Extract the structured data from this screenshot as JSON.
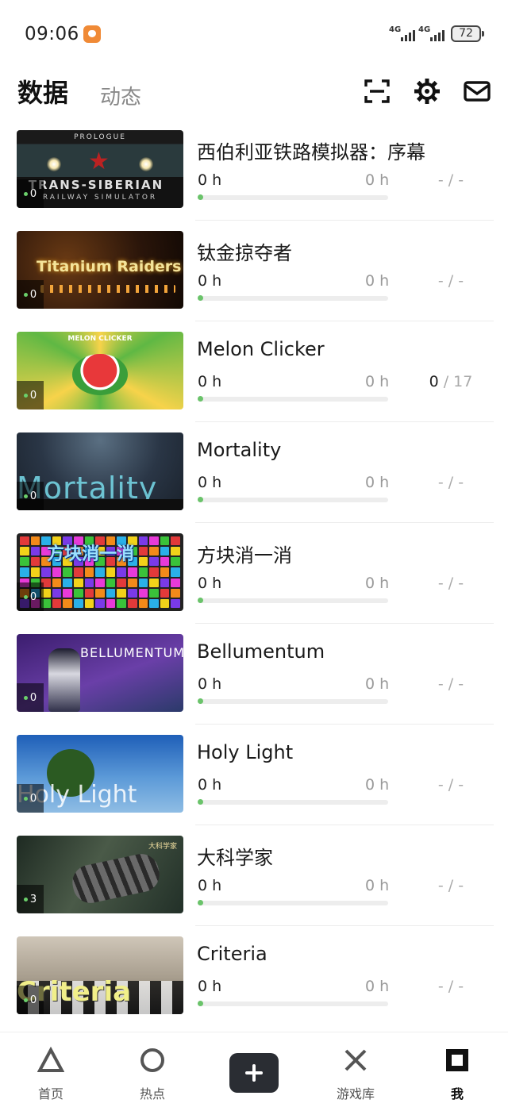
{
  "status_bar": {
    "time": "09:06",
    "network_1": "4G",
    "network_2": "4G",
    "battery": "72"
  },
  "header": {
    "tab_active": "数据",
    "tab_inactive": "动态",
    "icons": [
      "scan-icon",
      "gear-icon",
      "mail-icon"
    ]
  },
  "games": [
    {
      "title": "西伯利亚铁路模拟器：序幕",
      "badge": "0",
      "hours_left": "0 h",
      "hours_right": "0 h",
      "achieved": "",
      "achievements": "- / -",
      "progress": 0,
      "art": "siberian",
      "art_text": [
        "PROLOGUE",
        "TRANS-SIBERIAN",
        "RAILWAY SIMULATOR"
      ]
    },
    {
      "title": "钛金掠夺者",
      "badge": "0",
      "hours_left": "0 h",
      "hours_right": "0 h",
      "achieved": "",
      "achievements": "- / -",
      "progress": 0,
      "art": "titanium",
      "art_text": [
        "Titanium Raiders"
      ]
    },
    {
      "title": "Melon Clicker",
      "badge": "0",
      "hours_left": "0 h",
      "hours_right": "0 h",
      "achieved": "0",
      "achievements": " / 17",
      "progress": 0,
      "art": "melon",
      "art_text": [
        "MELON CLICKER"
      ]
    },
    {
      "title": "Mortality",
      "badge": "0",
      "hours_left": "0 h",
      "hours_right": "0 h",
      "achieved": "",
      "achievements": "- / -",
      "progress": 0,
      "art": "mortality",
      "art_text": [
        "Mortality"
      ]
    },
    {
      "title": "方块消一消",
      "badge": "0",
      "hours_left": "0 h",
      "hours_right": "0 h",
      "achieved": "",
      "achievements": "- / -",
      "progress": 0,
      "art": "blocks",
      "art_text": [
        "方块消一消"
      ]
    },
    {
      "title": "Bellumentum",
      "badge": "0",
      "hours_left": "0 h",
      "hours_right": "0 h",
      "achieved": "",
      "achievements": "- / -",
      "progress": 0,
      "art": "bellumentum",
      "art_text": [
        "BELLUMENTUM"
      ]
    },
    {
      "title": "Holy Light",
      "badge": "0",
      "hours_left": "0 h",
      "hours_right": "0 h",
      "achieved": "",
      "achievements": "- / -",
      "progress": 0,
      "art": "holy",
      "art_text": [
        "Holy Light"
      ]
    },
    {
      "title": "大科学家",
      "badge": "3",
      "hours_left": "0 h",
      "hours_right": "0 h",
      "achieved": "",
      "achievements": "- / -",
      "progress": 0,
      "art": "scientist",
      "art_text": [
        "大科学家"
      ]
    },
    {
      "title": "Criteria",
      "badge": "0",
      "hours_left": "0 h",
      "hours_right": "0 h",
      "achieved": "",
      "achievements": "- / -",
      "progress": 0,
      "art": "criteria",
      "art_text": [
        "Criteria"
      ]
    }
  ],
  "bottom_nav": [
    {
      "label": "首页",
      "icon": "triangle-icon"
    },
    {
      "label": "热点",
      "icon": "circle-icon"
    },
    {
      "label": "",
      "icon": "plus-icon"
    },
    {
      "label": "游戏库",
      "icon": "cross-icon"
    },
    {
      "label": "我",
      "icon": "square-icon"
    }
  ],
  "colors": {
    "progress_dot": "#6ac36a",
    "nav_button": "#2a2d33",
    "title_text": "#1a1a1a",
    "muted_text": "#999999"
  }
}
